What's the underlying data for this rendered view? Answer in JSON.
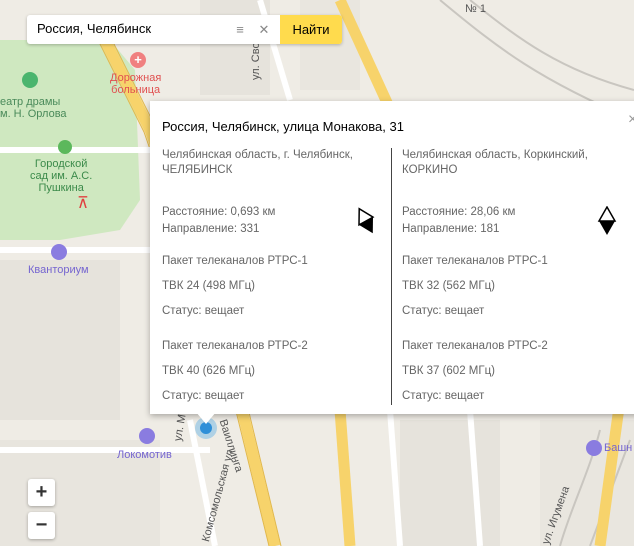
{
  "search": {
    "value": "Россия, Челябинск",
    "button_label": "Найти"
  },
  "map_labels": {
    "house_number": "№ 1",
    "hospital": [
      "Дорожная",
      "больница"
    ],
    "theatre": [
      "еатр драмы",
      "м. Н. Орлова"
    ],
    "garden": [
      "Городской",
      "сад им. А.С.",
      "Пушкина"
    ],
    "kvantorium": "Кванториум",
    "lokomotiv": "Локомотив",
    "street_svob": "ул. Свобо",
    "street_kirova": "ул. Мо",
    "street_vail": "Ваиллинга",
    "street_komsom": "Комсомольская ул.",
    "street_igumena": "ул. Игумена",
    "bashn": "Башн"
  },
  "zoom": {
    "plus": "+",
    "minus": "−"
  },
  "popup": {
    "title": "Россия, Челябинск, улица Монакова, 31",
    "close": "×",
    "left": {
      "location": "Челябинская область, г. Челябинск, ЧЕЛЯБИНСК",
      "distance": "Расстояние: 0,693 км",
      "direction": "Направление: 331",
      "pkg1": "Пакет телеканалов РТРС-1",
      "ch1": "ТВК 24 (498 МГц)",
      "status1": "Статус: вещает",
      "pkg2": "Пакет телеканалов РТРС-2",
      "ch2": "ТВК 40 (626 МГц)",
      "status2": "Статус: вещает",
      "arrow_icon": "direction-arrow-icon"
    },
    "right": {
      "location": "Челябинская область, Коркинский, КОРКИНО",
      "distance": "Расстояние: 28,06 км",
      "direction": "Направление: 181",
      "pkg1": "Пакет телеканалов РТРС-1",
      "ch1": "ТВК 32 (562 МГц)",
      "status1": "Статус: вещает",
      "pkg2": "Пакет телеканалов РТРС-2",
      "ch2": "ТВК 37 (602 МГц)",
      "status2": "Статус: вещает",
      "arrow_icon": "direction-arrow-icon"
    }
  },
  "colors": {
    "accent": "#ffdb4d",
    "road_major": "#f7d36b",
    "park": "#cfe8c0",
    "marker": "#3aa0e6"
  }
}
